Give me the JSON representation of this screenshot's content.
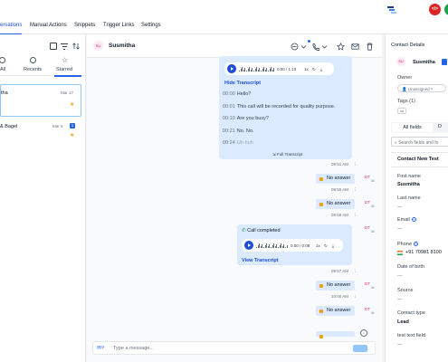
{
  "topbar": {
    "code_badge": "</>"
  },
  "nav": {
    "tabs": [
      "ersations",
      "Manual Actions",
      "Snippets",
      "Trigger Links",
      "Settings"
    ]
  },
  "left": {
    "tabs": [
      "All",
      "Recents",
      "Starred"
    ],
    "conversations": [
      {
        "name": "tha",
        "date": "Mar 17"
      },
      {
        "name": "& Bagel",
        "date": "Mar 6",
        "badge": "1"
      }
    ]
  },
  "chat": {
    "avatar": "SU",
    "name": "Susmitha",
    "player1": {
      "time": "0:00 / 1:10",
      "speed": "1x"
    },
    "hide_transcript": "Hide Transcript",
    "transcript": [
      {
        "t": "00:00",
        "text": "Hello?"
      },
      {
        "t": "00:01",
        "text": "This call will be recorded for quality purpose."
      },
      {
        "t": "00:10",
        "text": "Are you busy?"
      },
      {
        "t": "00:21",
        "text": "No. No."
      },
      {
        "t": "00:24",
        "text": "Uh-huh"
      }
    ],
    "full_transcript": "Full Transcript",
    "timestamps": [
      "09:51 AM",
      "09:55 AM",
      "09:58 AM",
      "09:57 AM",
      "10:00 AM"
    ],
    "no_answer": "No answer",
    "call_completed": "Call completed",
    "player2": {
      "time": "0:00 / 0:08",
      "speed": "1x"
    },
    "view_transcript": "View Transcript",
    "dt": "DT",
    "input_placeholder": "Type a message..."
  },
  "contact": {
    "title": "Contact Details",
    "avatar": "SU",
    "name": "Susmitha",
    "owner_label": "Owner",
    "owner_value": "Unassigned",
    "tags_label": "Tags (1)",
    "tag": "sa",
    "all_fields_tab": "All fields",
    "search_placeholder": "Search fields and fo",
    "section_title": "Contact New Test",
    "fields": [
      {
        "label": "First name",
        "value": "Susmitha"
      },
      {
        "label": "Last name",
        "value": "—"
      },
      {
        "label": "Email",
        "value": "—"
      },
      {
        "label": "Phone",
        "value": "+91 70981 8100"
      },
      {
        "label": "Date of birth",
        "value": "—"
      },
      {
        "label": "Source",
        "value": "—"
      },
      {
        "label": "Contact type",
        "value": "Lead"
      },
      {
        "label": "test text field",
        "value": "—"
      }
    ]
  },
  "colors": {
    "accent": "#2563eb",
    "bubble": "#dbeafe",
    "danger": "#dc2626"
  }
}
